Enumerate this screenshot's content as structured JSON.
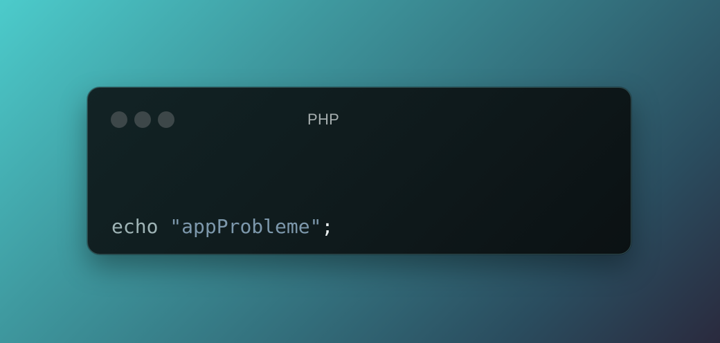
{
  "window": {
    "title": "PHP",
    "controls": [
      "close",
      "minimize",
      "maximize"
    ]
  },
  "code": {
    "language": "PHP",
    "lines": [
      {
        "tokens": [
          {
            "type": "keyword",
            "text": "echo"
          },
          {
            "type": "space",
            "text": " "
          },
          {
            "type": "string",
            "text": "\"appProbleme\""
          },
          {
            "type": "punctuation",
            "text": ";"
          }
        ]
      }
    ]
  },
  "colors": {
    "background_gradient": [
      "#4ccbcb",
      "#336f7c",
      "#2a2a3e"
    ],
    "window_bg": "#122325",
    "keyword": "#9fb4b6",
    "string": "#7d98ac",
    "punctuation": "#e9eeee",
    "title": "#a6aeaf",
    "control_dots": "#3d4749"
  }
}
